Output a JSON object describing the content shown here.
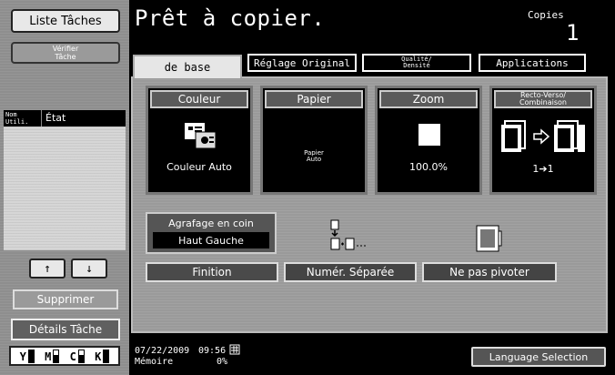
{
  "sidebar": {
    "job_list_button": "Liste Tâches",
    "verify_job_line1": "Vérifier",
    "verify_job_line2": "Tâche",
    "col_user_line1": "Nom",
    "col_user_line2": "Utili.",
    "col_state": "État",
    "up_arrow": "↑",
    "down_arrow": "↓",
    "delete_button": "Supprimer",
    "details_button": "Détails Tâche",
    "toner": [
      {
        "label": "Y"
      },
      {
        "label": "M"
      },
      {
        "label": "C"
      },
      {
        "label": "K"
      }
    ]
  },
  "header": {
    "status_title": "Prêt à copier.",
    "copies_label": "Copies",
    "copies_count": "1"
  },
  "tabs": [
    {
      "label": "de base",
      "active": true
    },
    {
      "label": "Réglage Original",
      "active": false
    },
    {
      "label_line1": "Qualité/",
      "label_line2": "Densité",
      "active": false
    },
    {
      "label": "Applications",
      "active": false
    }
  ],
  "functions": {
    "color": {
      "title": "Couleur",
      "value": "Couleur Auto"
    },
    "paper": {
      "title": "Papier",
      "value_line1": "Papier",
      "value_line2": "Auto"
    },
    "zoom": {
      "title": "Zoom",
      "value": "100.0%"
    },
    "duplex": {
      "title_line1": "Recto-Verso/",
      "title_line2": "Combinaison",
      "value": "1➔1"
    }
  },
  "finishing": {
    "staple_title": "Agrafage en coin",
    "staple_value": "Haut Gauche",
    "finish_button": "Finition",
    "separate_scan_button": "Numér. Séparée",
    "no_rotate_button": "Ne pas pivoter"
  },
  "footer": {
    "date": "07/22/2009",
    "time": "09:56",
    "memory_label": "Mémoire",
    "memory_value": "0%",
    "language_button": "Language Selection"
  }
}
